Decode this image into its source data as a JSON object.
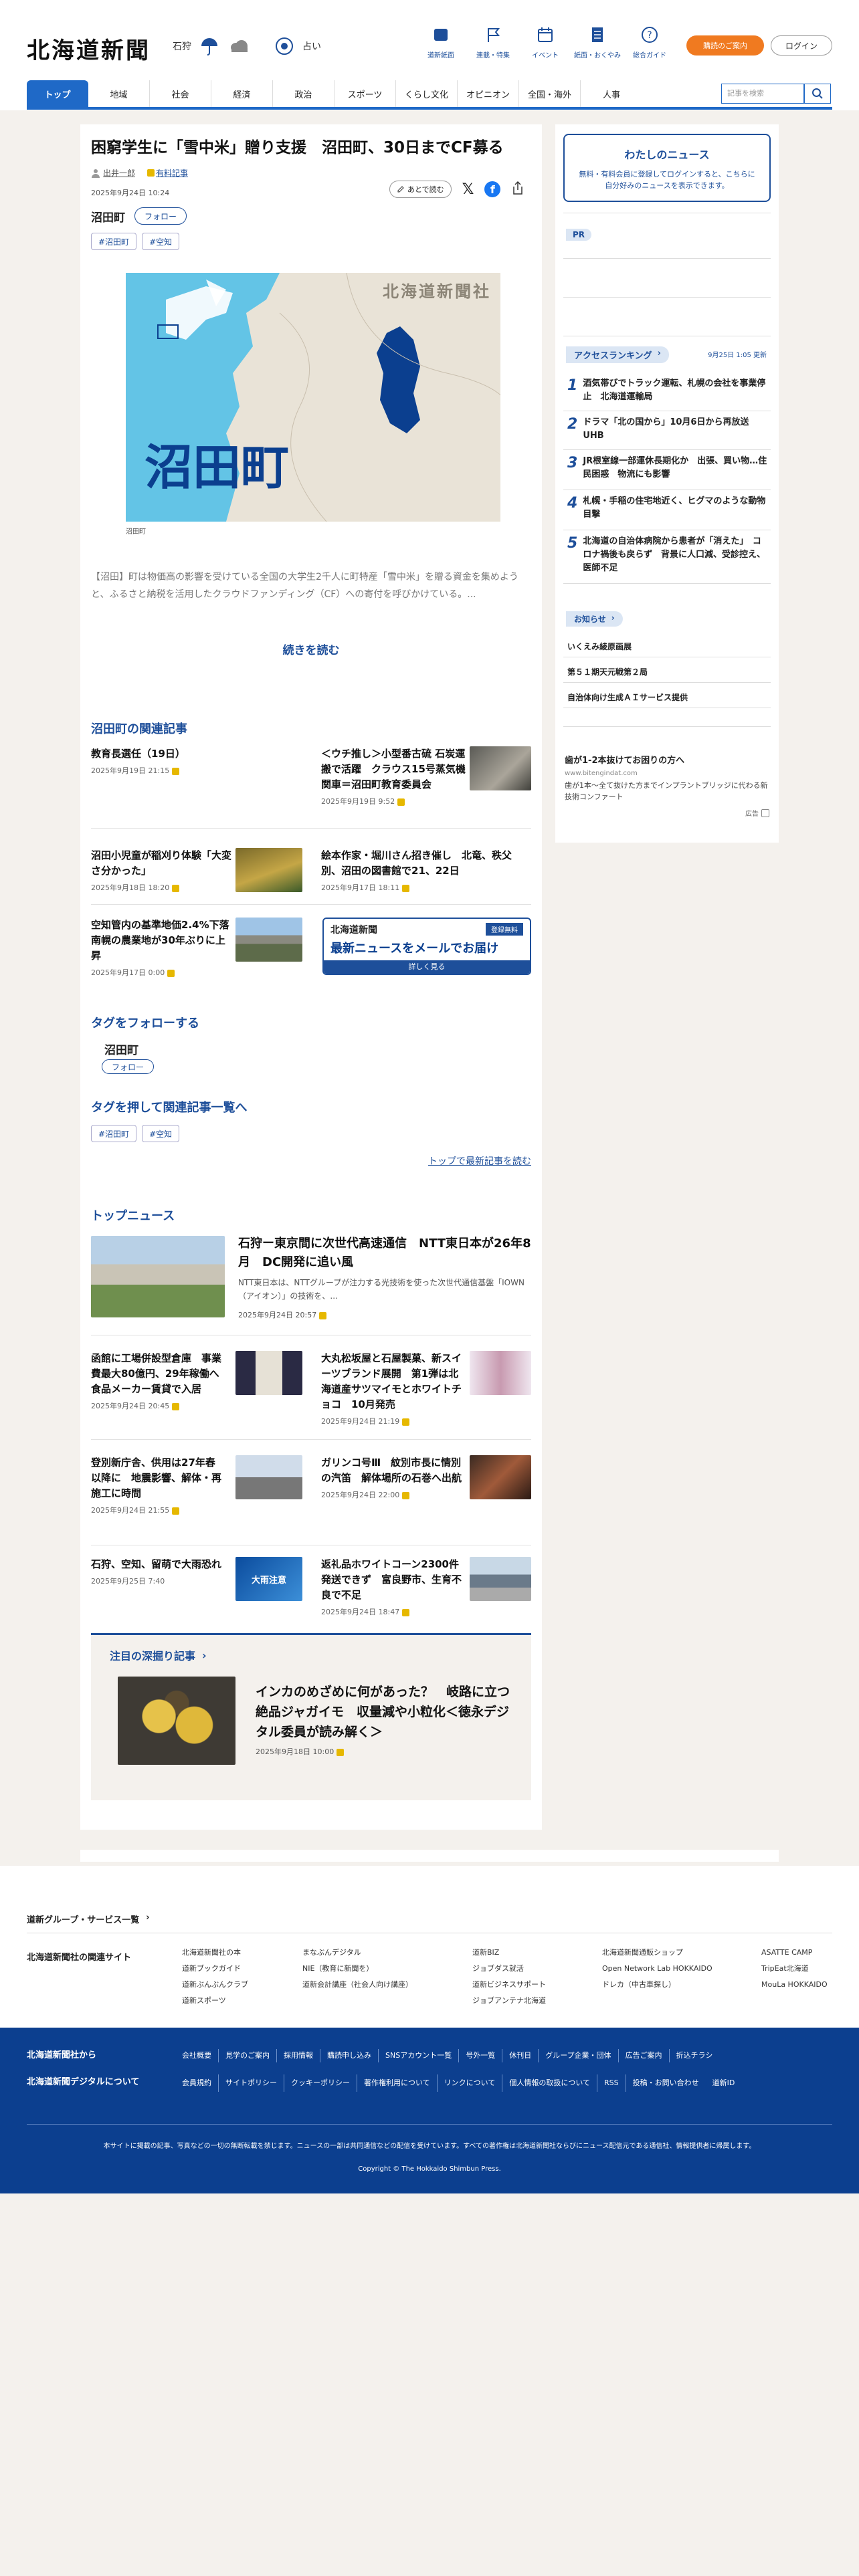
{
  "header": {
    "logo": "北海道新聞",
    "weather_city": "石狩",
    "fortune_label": "占い",
    "nav": [
      {
        "label": "道新紙面",
        "icon": "newspaper-icon"
      },
      {
        "label": "連載・特集",
        "icon": "flag-icon"
      },
      {
        "label": "イベント",
        "icon": "calendar-icon"
      },
      {
        "label": "紙面・おくやみ",
        "icon": "document-icon"
      },
      {
        "label": "総合ガイド",
        "icon": "question-icon"
      }
    ],
    "subscribe": "購読のご案内",
    "login": "ログイン"
  },
  "gnav": [
    "トップ",
    "地域",
    "社会",
    "経済",
    "政治",
    "スポーツ",
    "くらし文化",
    "オピニオン",
    "全国・海外",
    "人事"
  ],
  "search": {
    "placeholder": "記事を検索"
  },
  "article": {
    "title": "困窮学生に「雪中米」贈り支援　沼田町、30日までCF募る",
    "author": "出井一郎",
    "badge": "有料記事",
    "date": "2025年9月24日 10:24",
    "later": "あとで読む",
    "place": "沼田町",
    "follow": "フォロー",
    "tags": [
      "#沼田町",
      "#空知"
    ],
    "map_watermark": "北海道新聞社",
    "map_label": "沼田町",
    "caption": "沼田町",
    "lead": "【沼田】町は物価高の影響を受けている全国の大学生2千人に町特産「雪中米」を贈る資金を集めようと、ふるさと納税を活用したクラウドファンディング（CF）への寄付を呼びかけている。...",
    "more": "続きを読む"
  },
  "related": {
    "heading": "沼田町の関連記事",
    "items": [
      {
        "title": "教育長選任（19日）",
        "date": "2025年9月19日 21:15"
      },
      {
        "title": "＜ウチ推し＞小型番古硫 石炭運搬で活躍　クラウス15号蒸気機関車＝沼田町教育委員会",
        "date": "2025年9月19日 9:52"
      },
      {
        "title": "沼田小児童が稲刈り体験「大変さ分かった」",
        "date": "2025年9月18日 18:20"
      },
      {
        "title": "絵本作家・堀川さん招き催し　北竜、秩父別、沼田の図書館で21、22日",
        "date": "2025年9月17日 18:11"
      },
      {
        "title": "空知管内の基準地価2.4%下落　南幌の農業地が30年ぶりに上昇",
        "date": "2025年9月17日 0:00"
      }
    ],
    "mail_brand": "北海道新聞",
    "mail_sub": "登録無料",
    "mail_title": "最新ニュースをメールでお届け",
    "mail_more": "詳しく見る"
  },
  "follow_tags": {
    "heading": "タグをフォローする",
    "name": "沼田町",
    "follow": "フォロー"
  },
  "tag_list": {
    "heading": "タグを押して関連記事一覧へ",
    "tags": [
      "#沼田町",
      "#空知"
    ],
    "back": "トップで最新記事を読む"
  },
  "top_news": {
    "heading": "トップニュース",
    "lead": {
      "title": "石狩ー東京間に次世代高速通信　NTT東日本が26年8月　DC開発に追い風",
      "body": "NTT東日本は、NTTグループが注力する光技術を使った次世代通信基盤「IOWN（アイオン）」の技術を、...",
      "date": "2025年9月24日 20:57"
    },
    "items": [
      {
        "title": "函館に工場併設型倉庫　事業費最大80億円、29年稼働へ　食品メーカー賃貸で入居",
        "date": "2025年9月24日 20:45"
      },
      {
        "title": "大丸松坂屋と石屋製菓、新スイーツブランド展開　第1弾は北海道産サツマイモとホワイトチョコ　10月発売",
        "date": "2025年9月24日 21:19"
      },
      {
        "title": "登別新庁舎、供用は27年春以降に　地震影響、解体・再施工に時間",
        "date": "2025年9月24日 21:55"
      },
      {
        "title": "ガリンコ号Ⅲ　紋別市長に情別の汽笛　解体場所の石巻へ出航",
        "date": "2025年9月24日 22:00"
      },
      {
        "title": "石狩、空知、留萌で大雨恐れ",
        "date": "2025年9月25日 7:40"
      },
      {
        "title": "返礼品ホワイトコーン2300件発送できず　富良野市、生育不良で不足",
        "date": "2025年9月24日 18:47"
      }
    ],
    "weather_thumb": "大雨注意"
  },
  "deep": {
    "heading": "注目の深掘り記事",
    "title": "インカのめざめに何があった？　岐路に立つ絶品ジャガイモ　収量減や小粒化＜徳永デジタル委員が読み解く＞",
    "date": "2025年9月18日 10:00"
  },
  "sidebar": {
    "my_news_title": "わたしのニュース",
    "my_news_text": "無料・有料会員に登録してログインすると、こちらに自分好みのニュースを表示できます。",
    "pr": "PR",
    "ranking_title": "アクセスランキング",
    "ranking_time": "9月25日 1:05 更新",
    "ranking": [
      "酒気帯びでトラック運転、札幌の会社を事業停止　北海道運輸局",
      "ドラマ「北の国から」10月6日から再放送　UHB",
      "JR根室線一部運休長期化か　出張、買い物…住民困惑　物流にも影響",
      "札幌・手稲の住宅地近く、ヒグマのような動物目撃",
      "北海道の自治体病院から患者が「消えた」　コロナ禍後も戻らず　背景に人口減、受診控え、医師不足"
    ],
    "notice_title": "お知らせ",
    "notices": [
      "いくえみ綾原画展",
      "第５１期天元戦第２局",
      "自治体向け生成ＡＩサービス提供"
    ],
    "ad_title": "歯が1-2本抜けてお困りの方へ",
    "ad_url": "www.bitengindat.com",
    "ad_text": "歯が1本〜全て抜けた方までインプラントブリッジに代わる新技術コンファート",
    "ad_label": "広告"
  },
  "footer": {
    "group_title": "道新グループ・サービス一覧",
    "related_title": "北海道新聞社の関連サイト",
    "cols": [
      [
        "北海道新聞社の本",
        "道新ブックガイド",
        "道新ぶんぶんクラブ",
        "道新スポーツ"
      ],
      [
        "まなぶんデジタル",
        "NIE（教育に新聞を）",
        "道新会計講座（社会人向け講座）"
      ],
      [
        "道新BIZ",
        "ジョブダス就活",
        "道新ビジネスサポート",
        "ジョブアンテナ北海道"
      ],
      [
        "北海道新聞通販ショップ",
        "Open Network Lab HOKKAIDO",
        "ドレカ（中古車探し）"
      ],
      [
        "ASATTE CAMP",
        "TripEat北海道",
        "MouLa HOKKAIDO"
      ]
    ],
    "from_title": "北海道新聞社から",
    "digital_title": "北海道新聞デジタルについて",
    "links1": [
      "会社概要",
      "見学のご案内",
      "採用情報",
      "購読申し込み",
      "SNSアカウント一覧",
      "号外一覧",
      "休刊日",
      "グループ企業・団体",
      "広告ご案内",
      "折込チラシ"
    ],
    "links2": [
      "会員規約",
      "サイトポリシー",
      "クッキーポリシー",
      "著作権利用について",
      "リンクについて",
      "個人情報の取扱について",
      "RSS",
      "投稿・お問い合わせ",
      "道新ID"
    ],
    "notice": "本サイトに掲載の記事、写真などの一切の無断転載を禁じます。ニュースの一部は共同通信などの配信を受けています。すべての著作権は北海道新聞社ならびにニュース配信元である通信社、情報提供者に帰属します。",
    "copyright": "Copyright © The Hokkaido Shimbun Press."
  }
}
